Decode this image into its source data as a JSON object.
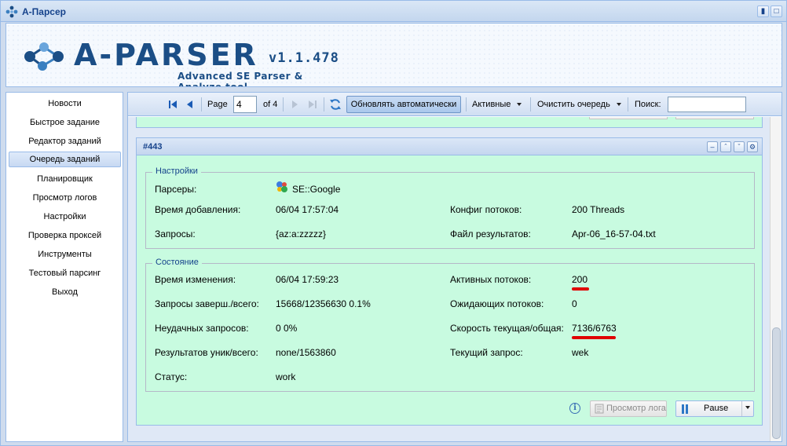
{
  "window": {
    "title": "А-Парсер"
  },
  "header": {
    "logo_word": "A-PARSER",
    "version": "v1.1.478",
    "tagline": "Advanced SE Parser & Analyze tool"
  },
  "sidebar": {
    "active_index": 3,
    "items": [
      {
        "label": "Новости"
      },
      {
        "label": "Быстрое задание"
      },
      {
        "label": "Редактор заданий"
      },
      {
        "label": "Очередь заданий"
      },
      {
        "label": "Планировщик"
      },
      {
        "label": "Просмотр логов"
      },
      {
        "label": "Настройки"
      },
      {
        "label": "Проверка проксей"
      },
      {
        "label": "Инструменты"
      },
      {
        "label": "Тестовый парсинг"
      },
      {
        "label": "Выход"
      }
    ]
  },
  "toolbar": {
    "page_label": "Page",
    "page_value": "4",
    "of_label": "of 4",
    "auto_refresh_label": "Обновлять автоматически",
    "filter_label": "Активные",
    "clear_label": "Очистить очередь",
    "search_label": "Поиск:",
    "search_value": ""
  },
  "job": {
    "title": "#443",
    "settings": {
      "legend": "Настройки",
      "parsers_label": "Парсеры:",
      "parsers_value": "SE::Google",
      "added_label": "Время добавления:",
      "added_value": "06/04 17:57:04",
      "threads_cfg_label": "Конфиг потоков:",
      "threads_cfg_value": "200 Threads",
      "queries_label": "Запросы:",
      "queries_value": "{az:a:zzzzz}",
      "result_file_label": "Файл результатов:",
      "result_file_value": "Apr-06_16-57-04.txt"
    },
    "state": {
      "legend": "Состояние",
      "changed_label": "Время изменения:",
      "changed_value": "06/04 17:59:23",
      "active_threads_label": "Активных потоков:",
      "active_threads_value": "200",
      "done_label": "Запросы заверш./всего:",
      "done_value": "15668/12356630 0.1%",
      "waiting_threads_label": "Ожидающих потоков:",
      "waiting_threads_value": "0",
      "failed_label": "Неудачных запросов:",
      "failed_value": "0 0%",
      "speed_label": "Скорость текущая/общая:",
      "speed_value": "7136/6763",
      "results_label": "Результатов уник/всего:",
      "results_value": "none/1563860",
      "current_query_label": "Текущий запрос:",
      "current_query_value": "wek",
      "status_label": "Статус:",
      "status_value": "work"
    },
    "actions": {
      "log_label": "Просмотр лога",
      "pause_label": "Pause"
    }
  },
  "colors": {
    "panel_bg": "#c8fbe0",
    "accent": "#15428b",
    "highlight": "#e00000"
  }
}
